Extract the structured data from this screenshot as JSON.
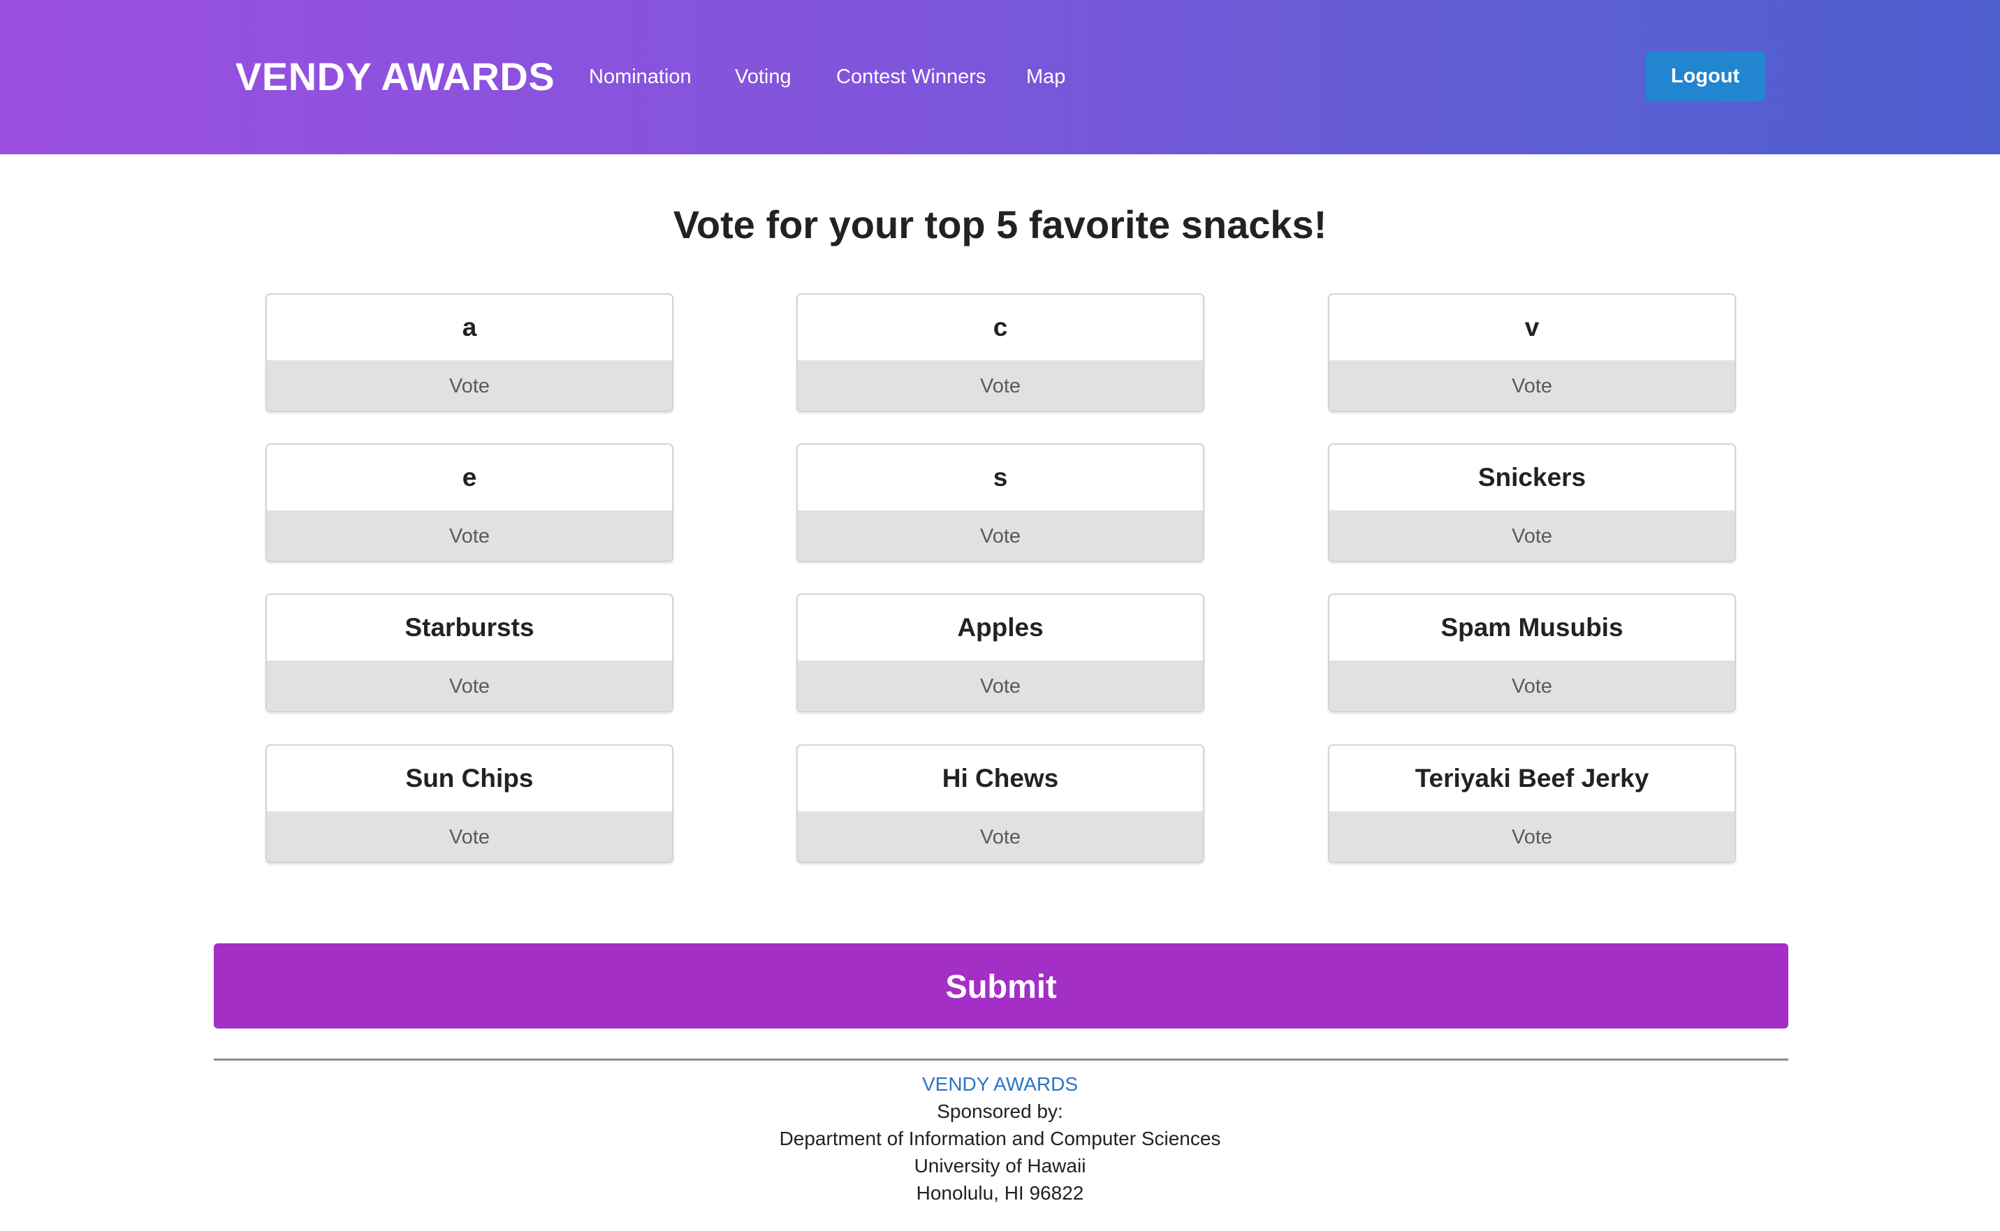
{
  "header": {
    "brand": "VENDY AWARDS",
    "nav": [
      "Nomination",
      "Voting",
      "Contest Winners",
      "Map"
    ],
    "logout_label": "Logout"
  },
  "main": {
    "title": "Vote for your top 5 favorite snacks!",
    "vote_label": "Vote",
    "snacks": [
      "a",
      "c",
      "v",
      "e",
      "s",
      "Snickers",
      "Starbursts",
      "Apples",
      "Spam Musubis",
      "Sun Chips",
      "Hi Chews",
      "Teriyaki Beef Jerky"
    ],
    "submit_label": "Submit"
  },
  "footer": {
    "brand": "VENDY AWARDS",
    "sponsored": "Sponsored by:",
    "dept": "Department of Information and Computer Sciences",
    "university": "University of Hawaii",
    "address": "Honolulu, HI 96822"
  },
  "colors": {
    "header_gradient_start": "#9b4fe0",
    "header_gradient_end": "#4d5ecf",
    "logout_button": "#2185d0",
    "submit_button": "#a32fc6",
    "footer_link": "#2b75c7"
  }
}
